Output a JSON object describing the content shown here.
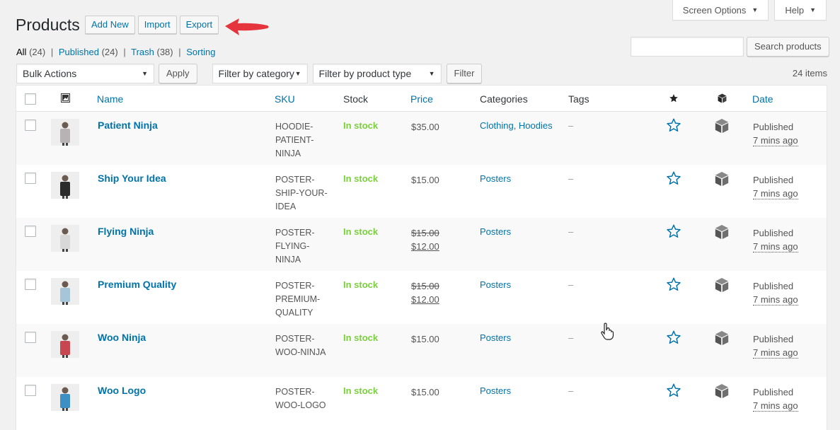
{
  "header": {
    "title": "Products",
    "actions": [
      "Add New",
      "Import",
      "Export"
    ],
    "screen_options": "Screen Options",
    "help": "Help"
  },
  "views": {
    "all": "All",
    "all_count": "(24)",
    "published": "Published",
    "published_count": "(24)",
    "trash": "Trash",
    "trash_count": "(38)",
    "sorting": "Sorting",
    "sep": "|"
  },
  "search": {
    "placeholder": "",
    "button": "Search products"
  },
  "tablenav": {
    "bulk_actions": "Bulk Actions",
    "apply": "Apply",
    "filter_category": "Filter by category",
    "filter_type": "Filter by product type",
    "filter": "Filter",
    "items_count": "24 items"
  },
  "columns": {
    "name": "Name",
    "sku": "SKU",
    "stock": "Stock",
    "price": "Price",
    "categories": "Categories",
    "tags": "Tags",
    "date": "Date"
  },
  "colors": {
    "accent": "#0073aa",
    "in_stock": "#7ad03a",
    "arrow": "#e5343c"
  },
  "rows": [
    {
      "name": "Patient Ninja",
      "sku": [
        "HOODIE-",
        "PATIENT-",
        "NINJA"
      ],
      "stock": "In stock",
      "price": "$35.00",
      "price_regular": "",
      "categories": "Clothing, Hoodies",
      "tags": "–",
      "status": "Published",
      "ago": "7 mins ago",
      "thumb_color": "#b9b2b4"
    },
    {
      "name": "Ship Your Idea",
      "sku": [
        "POSTER-",
        "SHIP-YOUR-",
        "IDEA"
      ],
      "stock": "In stock",
      "price": "$15.00",
      "price_regular": "",
      "categories": "Posters",
      "tags": "–",
      "status": "Published",
      "ago": "7 mins ago",
      "thumb_color": "#2b2b2b"
    },
    {
      "name": "Flying Ninja",
      "sku": [
        "POSTER-",
        "FLYING-",
        "NINJA"
      ],
      "stock": "In stock",
      "price": "$12.00",
      "price_regular": "$15.00",
      "categories": "Posters",
      "tags": "–",
      "status": "Published",
      "ago": "7 mins ago",
      "thumb_color": "#d8d8d8"
    },
    {
      "name": "Premium Quality",
      "sku": [
        "POSTER-",
        "PREMIUM-",
        "QUALITY"
      ],
      "stock": "In stock",
      "price": "$12.00",
      "price_regular": "$15.00",
      "categories": "Posters",
      "tags": "–",
      "status": "Published",
      "ago": "7 mins ago",
      "thumb_color": "#a7c5d9"
    },
    {
      "name": "Woo Ninja",
      "sku": [
        "POSTER-",
        "WOO-NINJA"
      ],
      "stock": "In stock",
      "price": "$15.00",
      "price_regular": "",
      "categories": "Posters",
      "tags": "–",
      "status": "Published",
      "ago": "7 mins ago",
      "thumb_color": "#c8464f"
    },
    {
      "name": "Woo Logo",
      "sku": [
        "POSTER-",
        "WOO-LOGO"
      ],
      "stock": "In stock",
      "price": "$15.00",
      "price_regular": "",
      "categories": "Posters",
      "tags": "–",
      "status": "Published",
      "ago": "7 mins ago",
      "thumb_color": "#3d8fc6"
    }
  ]
}
